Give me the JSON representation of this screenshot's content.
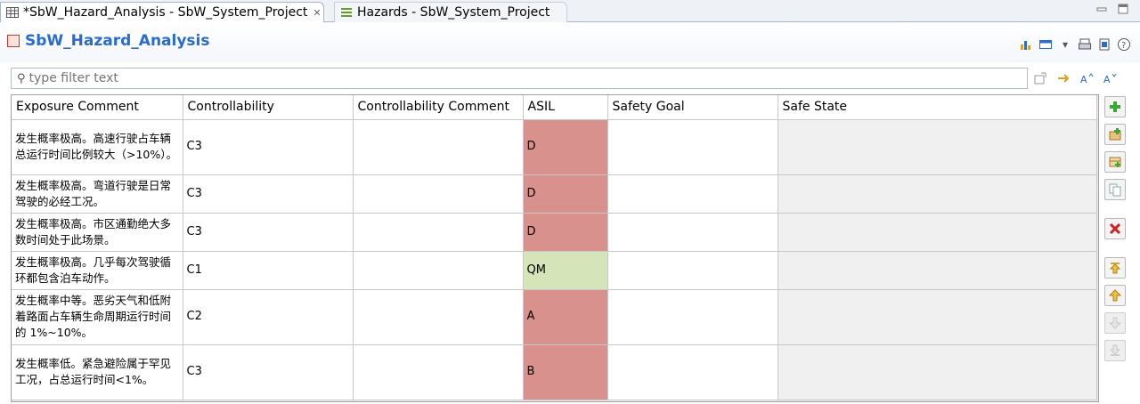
{
  "tabs": [
    {
      "label": "*SbW_Hazard_Analysis - SbW_System_Project",
      "active": true
    },
    {
      "label": "Hazards - SbW_System_Project",
      "active": false
    }
  ],
  "form": {
    "title": "SbW_Hazard_Analysis"
  },
  "filter": {
    "placeholder": "type filter text"
  },
  "table": {
    "columns": [
      "Exposure Comment",
      "Controllability",
      "Controllability Comment",
      "ASIL",
      "Safety Goal",
      "Safe State"
    ],
    "rows": [
      {
        "exposure_comment": "发生概率极高。高速行驶占车辆总运行时间比例较大（>10%）。",
        "controllability": "C3",
        "controllability_comment": "",
        "asil": "D",
        "safety_goal": "",
        "safe_state": ""
      },
      {
        "exposure_comment": "发生概率极高。弯道行驶是日常驾驶的必经工况。",
        "controllability": "C3",
        "controllability_comment": "",
        "asil": "D",
        "safety_goal": "",
        "safe_state": ""
      },
      {
        "exposure_comment": "发生概率极高。市区通勤绝大多数时间处于此场景。",
        "controllability": "C3",
        "controllability_comment": "",
        "asil": "D",
        "safety_goal": "",
        "safe_state": ""
      },
      {
        "exposure_comment": "发生概率极高。几乎每次驾驶循环都包含泊车动作。",
        "controllability": "C1",
        "controllability_comment": "",
        "asil": "QM",
        "safety_goal": "",
        "safe_state": ""
      },
      {
        "exposure_comment": "发生概率中等。恶劣天气和低附着路面占车辆生命周期运行时间的 1%~10%。",
        "controllability": "C2",
        "controllability_comment": "",
        "asil": "A",
        "safety_goal": "",
        "safe_state": ""
      },
      {
        "exposure_comment": "发生概率低。紧急避险属于罕见工况，占总运行时间<1%。",
        "controllability": "C3",
        "controllability_comment": "",
        "asil": "B",
        "safety_goal": "",
        "safe_state": ""
      }
    ]
  },
  "colors": {
    "title": "#2a6bd0",
    "asil_high": "#d8918d",
    "asil_qm": "#d5e4b9"
  },
  "side_buttons": [
    "add-icon",
    "add-child-icon",
    "add-table-icon",
    "copy-icon",
    "delete-icon",
    "move-top-icon",
    "move-up-icon",
    "move-down-icon",
    "move-bottom-icon"
  ]
}
